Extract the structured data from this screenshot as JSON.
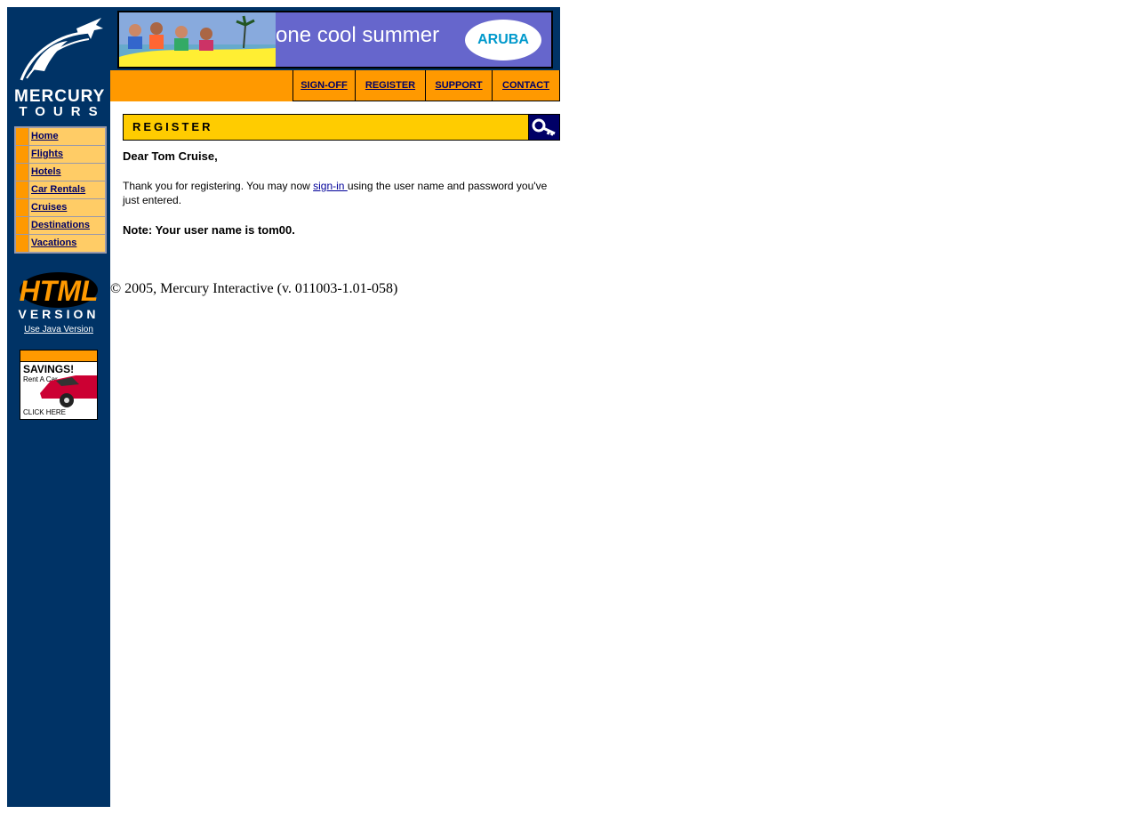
{
  "logo": {
    "line1": "MERCURY",
    "line2": "TOURS"
  },
  "sidebar": {
    "items": [
      {
        "label": "Home"
      },
      {
        "label": "Flights"
      },
      {
        "label": "Hotels"
      },
      {
        "label": "Car Rentals"
      },
      {
        "label": "Cruises"
      },
      {
        "label": "Destinations"
      },
      {
        "label": "Vacations"
      }
    ],
    "html_badge": "HTML",
    "html_badge_sub": "VERSION",
    "java_link": "Use Java Version"
  },
  "ad": {
    "headline": "SAVINGS!",
    "sub": "Rent A Car",
    "cta": "CLICK HERE"
  },
  "banner": {
    "text": "one cool summer",
    "brand": "ARUBA"
  },
  "topnav": {
    "signoff": "SIGN-OFF",
    "register": "REGISTER",
    "support": "SUPPORT",
    "contact": "CONTACT"
  },
  "section": {
    "title": "REGISTER"
  },
  "content": {
    "greeting": "Dear Tom Cruise,",
    "message_before": "Thank you for registering. You may now ",
    "signin_link": "sign-in ",
    "message_after": "using the user name and password you've just entered.",
    "note": "Note: Your user name is tom00."
  },
  "footer": {
    "copyright": "© 2005, Mercury Interactive (v. 011003-1.01-058)"
  },
  "colors": {
    "sidebar_bg": "#003366",
    "accent_orange": "#ff9900",
    "header_yellow": "#ffcc00",
    "link": "#000099"
  }
}
